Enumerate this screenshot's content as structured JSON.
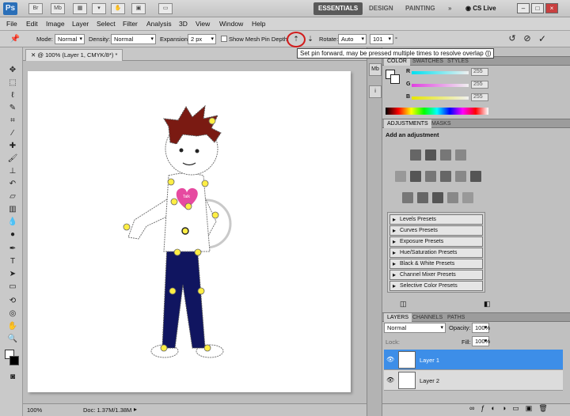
{
  "app": {
    "logo": "Ps",
    "icons": [
      "Br",
      "Mb"
    ],
    "workspaces": [
      "ESSENTIALS",
      "DESIGN",
      "PAINTING"
    ],
    "more_label": "»",
    "cslive": "CS Live"
  },
  "menu": [
    "File",
    "Edit",
    "Image",
    "Layer",
    "Select",
    "Filter",
    "Analysis",
    "3D",
    "View",
    "Window",
    "Help"
  ],
  "options": {
    "mode_label": "Mode:",
    "mode_value": "Normal",
    "density_label": "Density:",
    "density_value": "Normal",
    "expansion_label": "Expansion:",
    "expansion_value": "2 px",
    "show_mesh_label": "Show Mesh",
    "pin_depth_label": "Pin Depth:",
    "rotate_label": "Rotate:",
    "rotate_value": "Auto",
    "rotate_degrees": "101",
    "degree_symbol": "°"
  },
  "tooltip": "Set pin forward, may be pressed multiple times to resolve overlap (])",
  "document": {
    "tab_title": "@ 100% (Layer 1, CMYK/8*) *",
    "zoom": "100%",
    "doc_info": "Doc: 1.37M/1.38M",
    "heart_text": "Talk"
  },
  "color_panel": {
    "tabs": [
      "COLOR",
      "SWATCHES",
      "STYLES"
    ],
    "channels": [
      {
        "label": "R",
        "value": "255",
        "color": "#00d6e6"
      },
      {
        "label": "G",
        "value": "255",
        "color": "#e040e0"
      },
      {
        "label": "B",
        "value": "255",
        "color": "#e6e600"
      }
    ]
  },
  "adjustments_panel": {
    "tabs": [
      "ADJUSTMENTS",
      "MASKS"
    ],
    "title": "Add an adjustment",
    "presets": [
      "Levels Presets",
      "Curves Presets",
      "Exposure Presets",
      "Hue/Saturation Presets",
      "Black & White Presets",
      "Channel Mixer Presets",
      "Selective Color Presets"
    ]
  },
  "layers_panel": {
    "tabs": [
      "LAYERS",
      "CHANNELS",
      "PATHS"
    ],
    "blend_mode": "Normal",
    "opacity_label": "Opacity:",
    "opacity_value": "100%",
    "lock_label": "Lock:",
    "fill_label": "Fill:",
    "fill_value": "100%",
    "layers": [
      {
        "name": "Layer 1",
        "selected": true
      },
      {
        "name": "Layer 2",
        "selected": false
      }
    ]
  },
  "colors": {
    "accent": "#3d8ee8",
    "highlight_circle": "#d21c1c",
    "pin": "#ffee44",
    "hair": "#7a1a12",
    "pants": "#101560",
    "heart": "#e64aa0"
  }
}
